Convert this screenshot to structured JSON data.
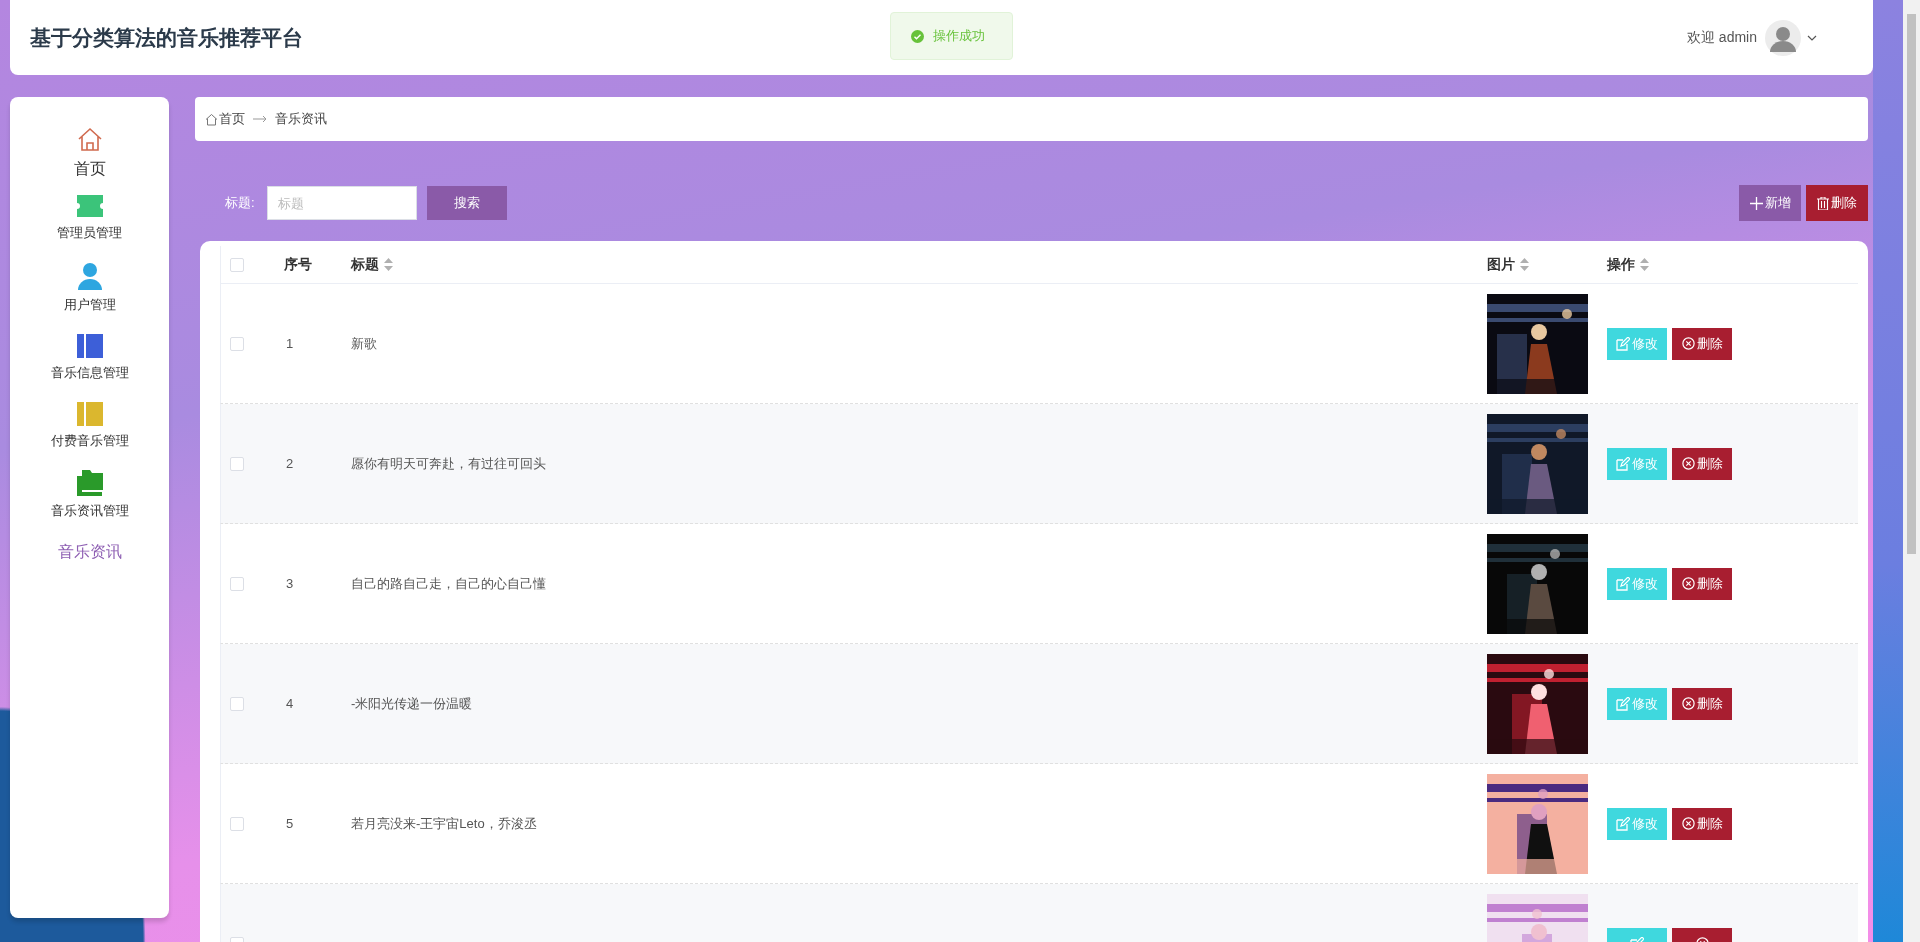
{
  "header": {
    "title": "基于分类算法的音乐推荐平台",
    "toast": {
      "text": "操作成功",
      "kind": "success"
    },
    "welcome": "欢迎 admin"
  },
  "sidebar": {
    "items": [
      {
        "label": "首页",
        "selected": false
      },
      {
        "label": "管理员管理",
        "selected": false
      },
      {
        "label": "用户管理",
        "selected": false
      },
      {
        "label": "音乐信息管理",
        "selected": false
      },
      {
        "label": "付费音乐管理",
        "selected": false
      },
      {
        "label": "音乐资讯管理",
        "selected": false
      },
      {
        "label": "音乐资讯",
        "selected": true
      }
    ]
  },
  "breadcrumb": [
    "首页",
    "音乐资讯"
  ],
  "search": {
    "label": "标题:",
    "placeholder": "标题",
    "button": "搜索"
  },
  "toolbar": [
    {
      "label": "新增",
      "kind": "add"
    },
    {
      "label": "删除",
      "kind": "delete"
    }
  ],
  "table": {
    "header_checked": false,
    "columns": [
      {
        "label": "序号",
        "sortable": false
      },
      {
        "label": "标题",
        "sortable": true
      },
      {
        "label": "图片",
        "sortable": true
      },
      {
        "label": "操作",
        "sortable": true
      }
    ],
    "rows": [
      {
        "index": "1",
        "title": "新歌",
        "checked": false,
        "actions": [
          {
            "label": "修改",
            "kind": "edit"
          },
          {
            "label": "删除",
            "kind": "delete"
          }
        ]
      },
      {
        "index": "2",
        "title": "愿你有明天可奔赴，有过往可回头",
        "checked": false,
        "actions": [
          {
            "label": "修改",
            "kind": "edit"
          },
          {
            "label": "删除",
            "kind": "delete"
          }
        ]
      },
      {
        "index": "3",
        "title": "自己的路自己走，自己的心自己懂",
        "checked": false,
        "actions": [
          {
            "label": "修改",
            "kind": "edit"
          },
          {
            "label": "删除",
            "kind": "delete"
          }
        ]
      },
      {
        "index": "4",
        "title": "-米阳光传递一份温暖",
        "checked": false,
        "actions": [
          {
            "label": "修改",
            "kind": "edit"
          },
          {
            "label": "删除",
            "kind": "delete"
          }
        ]
      },
      {
        "index": "5",
        "title": "若月亮没来-王宇宙Leto，乔浚丞",
        "checked": false,
        "actions": [
          {
            "label": "修改",
            "kind": "edit"
          },
          {
            "label": "删除",
            "kind": "delete"
          }
        ]
      },
      {
        "checked": false,
        "actions": [
          {
            "kind": "edit"
          },
          {
            "kind": "delete"
          }
        ]
      }
    ]
  }
}
